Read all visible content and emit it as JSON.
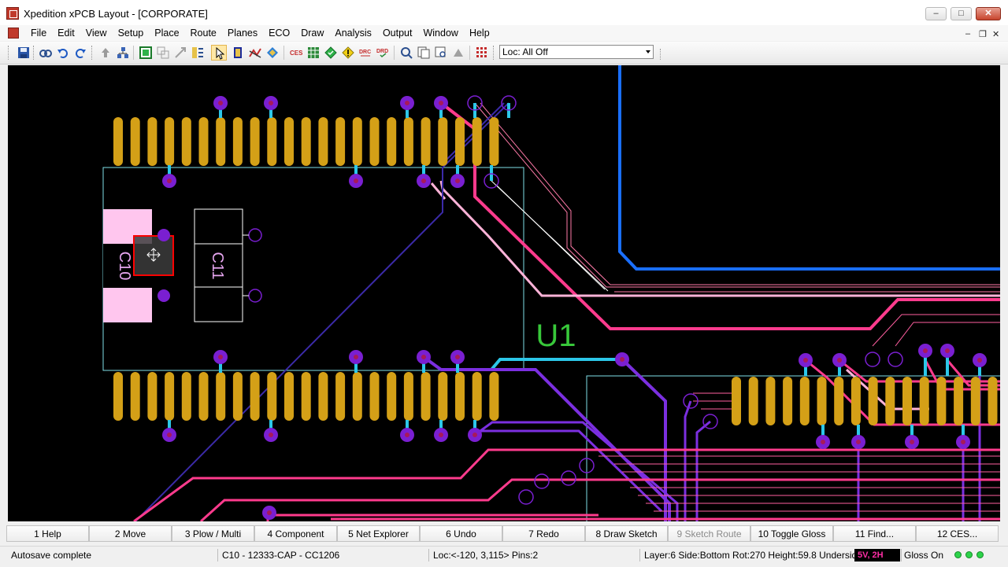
{
  "window": {
    "title": "Xpedition xPCB Layout   - [CORPORATE]",
    "minimize": "–",
    "maximize": "□",
    "close": "✕"
  },
  "menu": [
    "File",
    "Edit",
    "View",
    "Setup",
    "Place",
    "Route",
    "Planes",
    "ECO",
    "Draw",
    "Analysis",
    "Output",
    "Window",
    "Help"
  ],
  "mdi": {
    "minimize": "–",
    "restore": "❐",
    "close": "✕"
  },
  "toolbar": {
    "icons": [
      "save-icon",
      "find-icon",
      "undo-icon",
      "redo-icon",
      "push-icon",
      "tree-icon",
      "board-icon",
      "copy-icon",
      "move-icon",
      "filter-icon",
      "select-icon",
      "pads-icon",
      "route-icon",
      "tune-icon",
      "ces-icon",
      "grid-icon",
      "drc-diamond-icon",
      "warning-diamond-icon",
      "drc-icon",
      "drd-icon",
      "zoom-fit-icon",
      "zoom-icon",
      "zoom-window-icon",
      "pan-icon",
      "display-grid-icon"
    ],
    "ces_label": "CES",
    "drc_label": "DRC",
    "drd_label": "DRD",
    "loc_select": "Loc: All Off"
  },
  "canvas": {
    "ref_c10": "C10",
    "ref_c11": "C11",
    "ref_u1": "U1",
    "colors": {
      "background": "#000000",
      "pad_gold": "#d4a017",
      "via_purple": "#7a1fd1",
      "trace_pink": "#ff3b8d",
      "trace_blue": "#1a6fff",
      "trace_cyan": "#2cc7e8",
      "trace_violet": "#7b2fe0",
      "selection": "#ff0000",
      "silkscreen": "#e7a6f0",
      "refdes_green": "#38c83a"
    }
  },
  "function_keys": [
    {
      "label": "1 Help",
      "enabled": true
    },
    {
      "label": "2 Move",
      "enabled": true
    },
    {
      "label": "3 Plow / Multi",
      "enabled": true
    },
    {
      "label": "4 Component",
      "enabled": true
    },
    {
      "label": "5 Net Explorer",
      "enabled": true
    },
    {
      "label": "6 Undo",
      "enabled": true
    },
    {
      "label": "7 Redo",
      "enabled": true
    },
    {
      "label": "8 Draw Sketch",
      "enabled": true
    },
    {
      "label": "9 Sketch Route",
      "enabled": false
    },
    {
      "label": "10 Toggle Gloss",
      "enabled": true
    },
    {
      "label": "11 Find...",
      "enabled": true
    },
    {
      "label": "12 CES...",
      "enabled": true
    }
  ],
  "status": {
    "message": "Autosave complete",
    "component": "C10 - 12333-CAP - CC1206",
    "location": "Loc:<-120, 3,115> Pins:2",
    "layer_info": "Layer:6 Side:Bottom Rot:270 Height:59.8 Underside",
    "layer_badge": "5V, 2H",
    "gloss": "Gloss On"
  }
}
